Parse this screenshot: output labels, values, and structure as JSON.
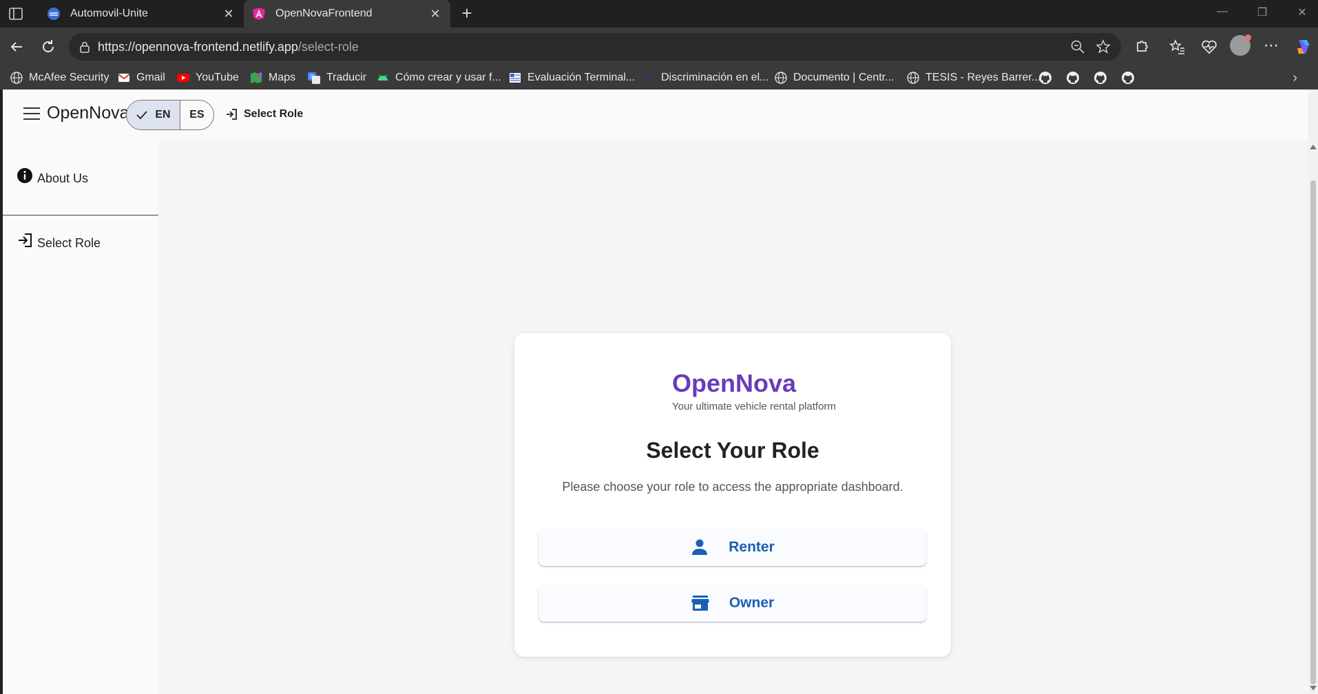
{
  "browser": {
    "tabs": [
      {
        "title": "Automovil-Unite",
        "active": false,
        "icon": "edge-globe-icon"
      },
      {
        "title": "OpenNovaFrontend",
        "active": true,
        "icon": "angular-icon"
      }
    ],
    "new_tab_label": "+",
    "address": {
      "host": "https://opennova-frontend.netlify.app",
      "path": "/select-role"
    },
    "bookmarks": [
      {
        "label": "McAfee Security",
        "icon": "globe-icon"
      },
      {
        "label": "Gmail",
        "icon": "gmail-icon"
      },
      {
        "label": "YouTube",
        "icon": "youtube-icon"
      },
      {
        "label": "Maps",
        "icon": "maps-icon"
      },
      {
        "label": "Traducir",
        "icon": "translate-icon"
      },
      {
        "label": "Cómo crear y usar f...",
        "icon": "android-icon"
      },
      {
        "label": "Evaluación Terminal...",
        "icon": "doc-icon"
      },
      {
        "label": "Discriminación en el...",
        "icon": "dot-icon"
      },
      {
        "label": "Documento | Centr...",
        "icon": "globe-icon"
      },
      {
        "label": "TESIS - Reyes Barrer...",
        "icon": "globe-icon"
      }
    ],
    "github_bookmark_count": 4
  },
  "app": {
    "brand": "OpenNova",
    "lang": {
      "selected": "EN",
      "other": "ES"
    },
    "appbar_link": "Select Role",
    "sidenav": [
      {
        "label": "About Us",
        "icon": "info-icon"
      },
      {
        "label": "Select Role",
        "icon": "login-icon"
      }
    ]
  },
  "card": {
    "brand": "OpenNova",
    "tagline": "Your ultimate vehicle rental platform",
    "title": "Select Your Role",
    "subtitle": "Please choose your role to access the appropriate dashboard.",
    "buttons": [
      {
        "label": "Renter",
        "icon": "person-icon"
      },
      {
        "label": "Owner",
        "icon": "store-icon"
      }
    ]
  },
  "colors": {
    "brand_purple": "#6a3bbb",
    "button_blue": "#1a5fb4"
  }
}
